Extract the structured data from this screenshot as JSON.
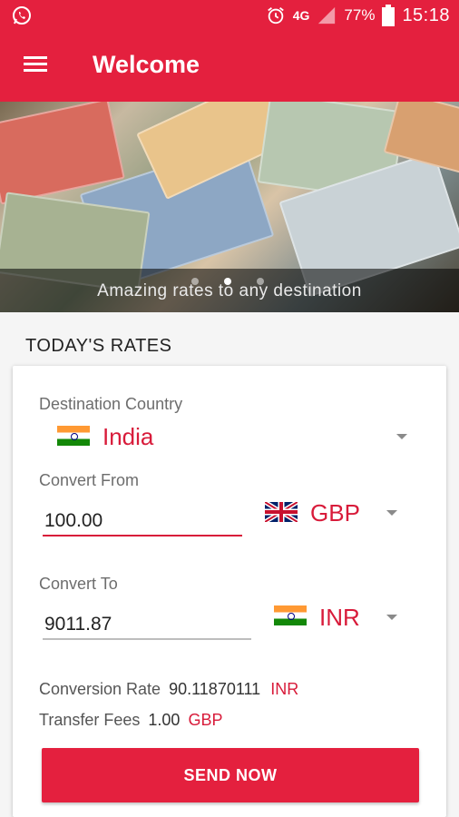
{
  "status_bar": {
    "network": "4G",
    "battery": "77%",
    "time": "15:18",
    "icons": [
      "whatsapp-icon",
      "alarm-icon",
      "signal-icon",
      "battery-icon"
    ]
  },
  "app_bar": {
    "title": "Welcome",
    "menu_icon": "menu-icon"
  },
  "hero": {
    "caption": "Amazing rates to any destination",
    "slides_count": 3,
    "active_slide": 2
  },
  "rates": {
    "section_title": "TODAY'S RATES",
    "destination_label": "Destination Country",
    "destination_value": "India",
    "convert_from_label": "Convert From",
    "convert_from_value": "100.00",
    "convert_from_currency": "GBP",
    "convert_to_label": "Convert To",
    "convert_to_value": "9011.87",
    "convert_to_currency": "INR",
    "conversion_rate_label": "Conversion Rate",
    "conversion_rate_value": "90.11870111",
    "conversion_rate_unit": "INR",
    "transfer_fees_label": "Transfer Fees",
    "transfer_fees_value": "1.00",
    "transfer_fees_unit": "GBP",
    "send_button": "SEND NOW"
  },
  "colors": {
    "primary": "#e4203e",
    "accent_text": "#d81b3a"
  }
}
